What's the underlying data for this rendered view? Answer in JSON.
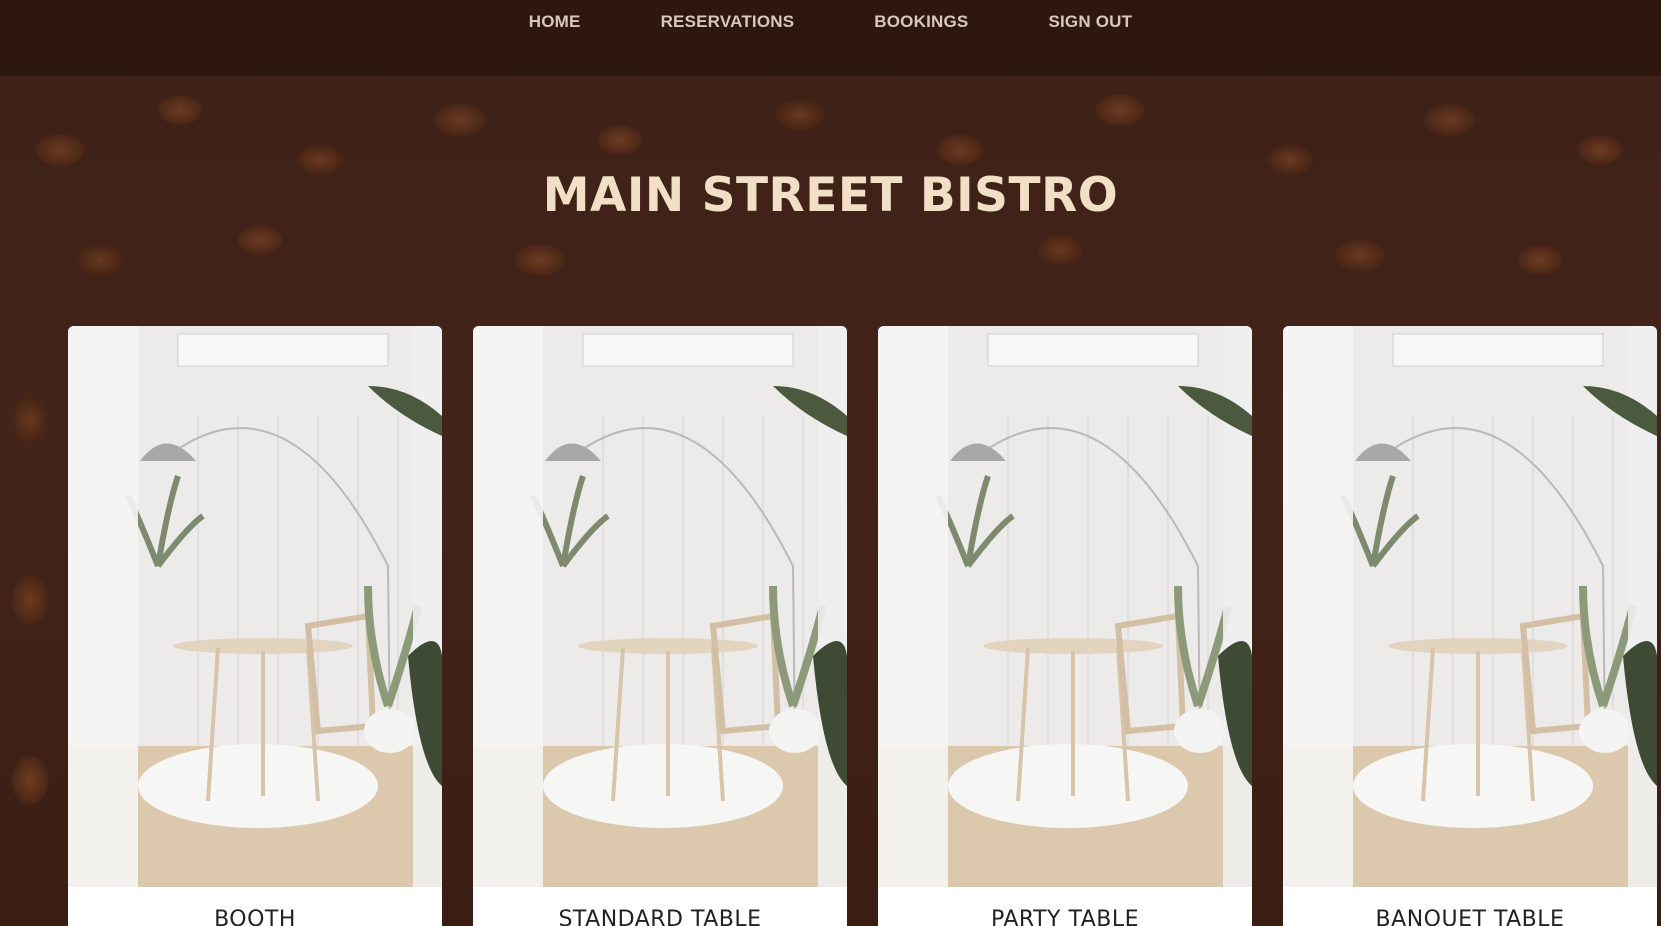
{
  "nav": {
    "items": [
      {
        "label": "HOME"
      },
      {
        "label": "RESERVATIONS"
      },
      {
        "label": "BOOKINGS"
      },
      {
        "label": "SIGN OUT"
      }
    ]
  },
  "hero": {
    "title": "MAIN STREET BISTRO"
  },
  "cards": [
    {
      "label": "BOOTH",
      "image": "dining-room-photo"
    },
    {
      "label": "STANDARD TABLE",
      "image": "dining-room-photo"
    },
    {
      "label": "PARTY TABLE",
      "image": "dining-room-photo"
    },
    {
      "label": "BANQUET TABLE",
      "image": "dining-room-photo"
    }
  ],
  "colors": {
    "nav_bg": "#2e170f",
    "nav_text": "#d9c7bb",
    "title_text": "#f2e0c6",
    "card_bg": "#ffffff"
  }
}
